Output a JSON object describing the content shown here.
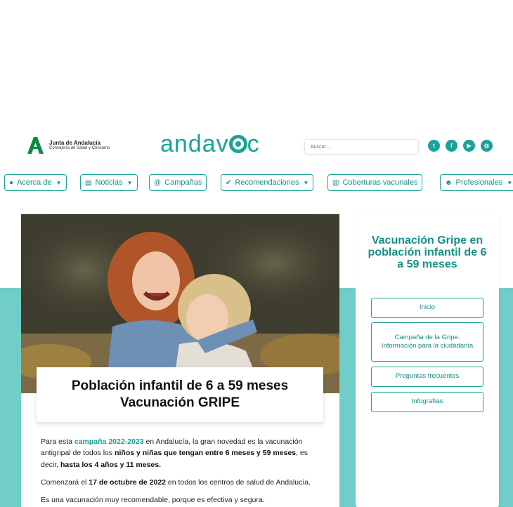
{
  "header": {
    "org_name": "Junta de Andalucía",
    "org_sub": "Consejería de Salud y Consumo",
    "brand_pre": "andav",
    "brand_post": "c",
    "search_placeholder": "Buscar ...",
    "social": [
      {
        "icon": "twitter-icon",
        "glyph": "t"
      },
      {
        "icon": "facebook-icon",
        "glyph": "f"
      },
      {
        "icon": "youtube-icon",
        "glyph": "▶"
      },
      {
        "icon": "instagram-icon",
        "glyph": "◎"
      }
    ]
  },
  "nav": {
    "items": [
      {
        "label": "Acerca de",
        "icon": "info-icon",
        "glyph": "●",
        "has_dropdown": true
      },
      {
        "label": "Noticias",
        "icon": "newspaper-icon",
        "glyph": "▤",
        "has_dropdown": true
      },
      {
        "label": "Campañas",
        "icon": "at-icon",
        "glyph": "@",
        "has_dropdown": false
      },
      {
        "label": "Recomendaciones",
        "icon": "check-icon",
        "glyph": "✔",
        "has_dropdown": true
      },
      {
        "label": "Coberturas vacunales",
        "icon": "bar-chart-icon",
        "glyph": "▥",
        "has_dropdown": false
      },
      {
        "label": "Profesionales",
        "icon": "users-icon",
        "glyph": "☻",
        "has_dropdown": true
      }
    ]
  },
  "main": {
    "title_line1": "Población infantil de 6 a 59 meses",
    "title_line2": "Vacunación GRIPE",
    "p1_a": "Para esta ",
    "p1_hl": "campaña 2022-2023",
    "p1_b": " en Andalucía, la gran novedad es la vacunación antigripal de todos los ",
    "p1_bold1": "niños y niñas que tengan entre 6 meses y 59 meses",
    "p1_c": ", es decir, ",
    "p1_bold2": "hasta los 4 años y 11 meses.",
    "p2_a": "Comenzará el ",
    "p2_bold": "17 de octubre de 2022",
    "p2_b": " en todos los centros de salud de Andalucía.",
    "p3": "Es una vacunación muy recomendable, porque es efectiva y segura."
  },
  "sidebar": {
    "title": "Vacunación Gripe en población infantil de 6 a 59 meses",
    "buttons": [
      {
        "label": "Inicio"
      },
      {
        "label": "Campaña de la Gripe. Información para la ciudadanía"
      },
      {
        "label": "Preguntas frecuentes"
      },
      {
        "label": "Infografías"
      }
    ]
  },
  "colors": {
    "accent": "#1aa398",
    "band": "#71cdc8"
  }
}
